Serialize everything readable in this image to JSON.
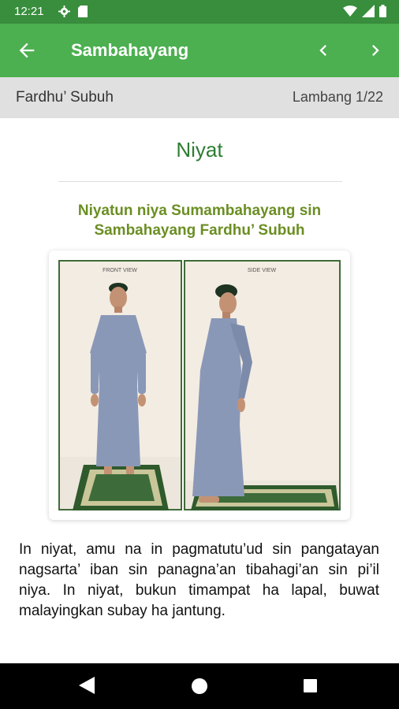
{
  "status_bar": {
    "time": "12:21",
    "icons": [
      "gear-icon",
      "sd-card-icon",
      "wifi-icon",
      "signal-icon",
      "battery-icon"
    ]
  },
  "app_bar": {
    "title": "Sambahayang",
    "back_icon": "arrow-left-icon",
    "prev_icon": "chevron-left-icon",
    "next_icon": "chevron-right-icon",
    "color": "#4caf50"
  },
  "sub_header": {
    "title": "Fardhu’ Subuh",
    "step": "Lambang 1/22"
  },
  "content": {
    "section_title": "Niyat",
    "subtitle": "Niyatun niya Sumambahayang sin Sambahayang Fardhu’ Subuh",
    "image": {
      "front_label": "FRONT VIEW",
      "side_label": "SIDE VIEW"
    },
    "body": "In niyat, amu na in pagmatutu’ud sin pangatayan nagsarta’ iban sin panagna’an tibahagi’an sin pi’il niya. In niyat, bukun timampat ha lapal, buwat malayingkan subay ha jantung."
  },
  "colors": {
    "title_green": "#2e7d32",
    "subtitle_olive": "#6b8e23",
    "status_green": "#388e3c"
  }
}
